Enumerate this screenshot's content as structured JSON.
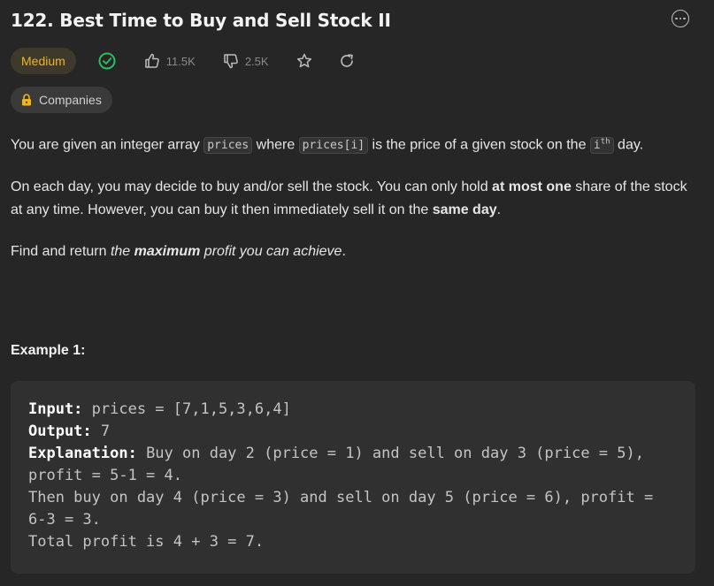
{
  "problem": {
    "title": "122. Best Time to Buy and Sell Stock II",
    "difficulty": "Medium",
    "likes": "11.5K",
    "dislikes": "2.5K",
    "companies_label": "Companies"
  },
  "colors": {
    "difficulty": "#f0b51c",
    "solved": "#2cbb5d",
    "background": "#262626"
  },
  "icons": {
    "more": "more-options-icon",
    "solved": "check-circle-icon",
    "like": "thumbs-up-icon",
    "dislike": "thumbs-down-icon",
    "favorite": "star-icon",
    "refresh": "refresh-icon",
    "lock": "lock-icon"
  },
  "description": {
    "p1_a": "You are given an integer array ",
    "p1_code1": "prices",
    "p1_b": " where ",
    "p1_code2": "prices[i]",
    "p1_c": " is the price of a given stock on the ",
    "p1_code3": "i",
    "p1_sup": "th",
    "p1_d": " day.",
    "p2_a": "On each day, you may decide to buy and/or sell the stock. You can only hold ",
    "p2_bold1": "at most one",
    "p2_b": " share of the stock at any time. However, you can buy it then immediately sell it on the ",
    "p2_bold2": "same day",
    "p2_c": ".",
    "p3_a": "Find and return ",
    "p3_em_a": "the ",
    "p3_em_bold": "maximum",
    "p3_em_b": " profit you can achieve",
    "p3_c": "."
  },
  "example": {
    "title": "Example 1:",
    "input_label": "Input:",
    "input_value": " prices = [7,1,5,3,6,4]",
    "output_label": "Output:",
    "output_value": " 7",
    "explanation_label": "Explanation:",
    "explanation_line1": " Buy on day 2 (price = 1) and sell on day 3 (price = 5), profit = 5-1 = 4.",
    "explanation_line2": "Then buy on day 4 (price = 3) and sell on day 5 (price = 6), profit = 6-3 = 3.",
    "explanation_line3": "Total profit is 4 + 3 = 7."
  }
}
